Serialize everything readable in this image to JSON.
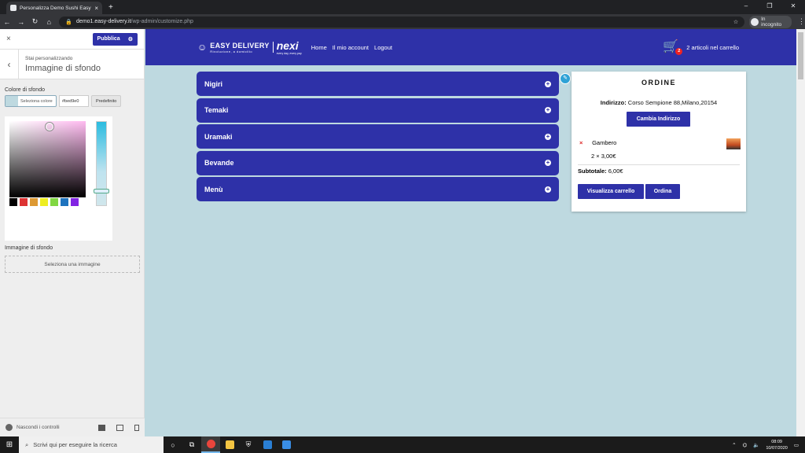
{
  "browser": {
    "tab_title": "Personalizza Demo Sushi Easy De",
    "tab_close": "×",
    "new_tab": "+",
    "url_host": "demo1.easy-delivery.it",
    "url_path": "/wp-admin/customize.php",
    "incognito_label": "In incognito",
    "window_controls": [
      "–",
      "❐",
      "✕"
    ]
  },
  "customizer": {
    "close": "×",
    "publish_label": "Pubblica",
    "back": "‹",
    "customizing_label": "Stai personalizzando",
    "section_title": "Immagine di sfondo",
    "color_label": "Colore di sfondo",
    "select_color_label": "Seleziona colore",
    "hex_value": "#bed9e0",
    "default_label": "Predefinito",
    "palette": [
      "#000000",
      "#dd3333",
      "#dd9933",
      "#eeee22",
      "#81d742",
      "#1e73be",
      "#8224e3"
    ],
    "image_label": "Immagine di sfondo",
    "select_image_label": "Seleziona una immagine",
    "hide_controls_label": "Nascondi i controlli"
  },
  "site": {
    "brand_name": "EASY DELIVERY",
    "brand_tagline": "Rivoluzione, a domicilio",
    "partner_name": "nexi",
    "partner_tagline": "every day, every pay",
    "nav": [
      "Home",
      "Il mio account",
      "Logout"
    ],
    "cart_count": "2",
    "cart_label": "2 articoli nel carrello",
    "categories": [
      "Nigiri",
      "Temaki",
      "Uramaki",
      "Bevande",
      "Menù"
    ],
    "order": {
      "title": "ORDINE",
      "address_label": "Indirizzo:",
      "address_value": "Corso Sempione 88,Milano,20154",
      "change_address": "Cambia Indirizzo",
      "item_remove": "×",
      "item_name": "Gambero",
      "item_qty": "2 × 3,00€",
      "subtotal_label": "Subtotale:",
      "subtotal_value": "6,00€",
      "view_cart": "Visualizza carrello",
      "checkout": "Ordina"
    }
  },
  "taskbar": {
    "search_placeholder": "Scrivi qui per eseguire la ricerca",
    "time": "08:09",
    "date": "10/07/2020"
  },
  "colors": {
    "brand": "#2e31a8",
    "background": "#bed9e0"
  }
}
